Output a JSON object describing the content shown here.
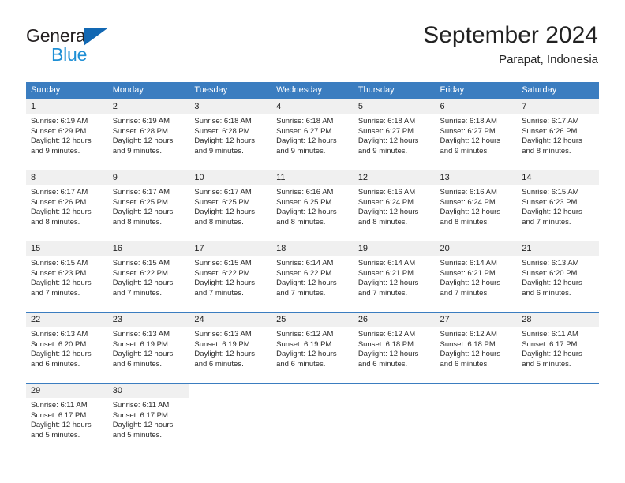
{
  "logo": {
    "word_top": "General",
    "word_bottom": "Blue",
    "triangle_color": "#1268b3",
    "blue_text_color": "#1e8fd5"
  },
  "header": {
    "title": "September 2024",
    "location": "Parapat, Indonesia"
  },
  "theme": {
    "header_blue": "#3b7dc0",
    "daynum_bg": "#f0f0f0",
    "text_color": "#2b2b2b"
  },
  "calendar": {
    "weekday_headers": [
      "Sunday",
      "Monday",
      "Tuesday",
      "Wednesday",
      "Thursday",
      "Friday",
      "Saturday"
    ],
    "weeks": [
      [
        {
          "day": "1",
          "sunrise": "Sunrise: 6:19 AM",
          "sunset": "Sunset: 6:29 PM",
          "daylight_1": "Daylight: 12 hours",
          "daylight_2": "and 9 minutes."
        },
        {
          "day": "2",
          "sunrise": "Sunrise: 6:19 AM",
          "sunset": "Sunset: 6:28 PM",
          "daylight_1": "Daylight: 12 hours",
          "daylight_2": "and 9 minutes."
        },
        {
          "day": "3",
          "sunrise": "Sunrise: 6:18 AM",
          "sunset": "Sunset: 6:28 PM",
          "daylight_1": "Daylight: 12 hours",
          "daylight_2": "and 9 minutes."
        },
        {
          "day": "4",
          "sunrise": "Sunrise: 6:18 AM",
          "sunset": "Sunset: 6:27 PM",
          "daylight_1": "Daylight: 12 hours",
          "daylight_2": "and 9 minutes."
        },
        {
          "day": "5",
          "sunrise": "Sunrise: 6:18 AM",
          "sunset": "Sunset: 6:27 PM",
          "daylight_1": "Daylight: 12 hours",
          "daylight_2": "and 9 minutes."
        },
        {
          "day": "6",
          "sunrise": "Sunrise: 6:18 AM",
          "sunset": "Sunset: 6:27 PM",
          "daylight_1": "Daylight: 12 hours",
          "daylight_2": "and 9 minutes."
        },
        {
          "day": "7",
          "sunrise": "Sunrise: 6:17 AM",
          "sunset": "Sunset: 6:26 PM",
          "daylight_1": "Daylight: 12 hours",
          "daylight_2": "and 8 minutes."
        }
      ],
      [
        {
          "day": "8",
          "sunrise": "Sunrise: 6:17 AM",
          "sunset": "Sunset: 6:26 PM",
          "daylight_1": "Daylight: 12 hours",
          "daylight_2": "and 8 minutes."
        },
        {
          "day": "9",
          "sunrise": "Sunrise: 6:17 AM",
          "sunset": "Sunset: 6:25 PM",
          "daylight_1": "Daylight: 12 hours",
          "daylight_2": "and 8 minutes."
        },
        {
          "day": "10",
          "sunrise": "Sunrise: 6:17 AM",
          "sunset": "Sunset: 6:25 PM",
          "daylight_1": "Daylight: 12 hours",
          "daylight_2": "and 8 minutes."
        },
        {
          "day": "11",
          "sunrise": "Sunrise: 6:16 AM",
          "sunset": "Sunset: 6:25 PM",
          "daylight_1": "Daylight: 12 hours",
          "daylight_2": "and 8 minutes."
        },
        {
          "day": "12",
          "sunrise": "Sunrise: 6:16 AM",
          "sunset": "Sunset: 6:24 PM",
          "daylight_1": "Daylight: 12 hours",
          "daylight_2": "and 8 minutes."
        },
        {
          "day": "13",
          "sunrise": "Sunrise: 6:16 AM",
          "sunset": "Sunset: 6:24 PM",
          "daylight_1": "Daylight: 12 hours",
          "daylight_2": "and 8 minutes."
        },
        {
          "day": "14",
          "sunrise": "Sunrise: 6:15 AM",
          "sunset": "Sunset: 6:23 PM",
          "daylight_1": "Daylight: 12 hours",
          "daylight_2": "and 7 minutes."
        }
      ],
      [
        {
          "day": "15",
          "sunrise": "Sunrise: 6:15 AM",
          "sunset": "Sunset: 6:23 PM",
          "daylight_1": "Daylight: 12 hours",
          "daylight_2": "and 7 minutes."
        },
        {
          "day": "16",
          "sunrise": "Sunrise: 6:15 AM",
          "sunset": "Sunset: 6:22 PM",
          "daylight_1": "Daylight: 12 hours",
          "daylight_2": "and 7 minutes."
        },
        {
          "day": "17",
          "sunrise": "Sunrise: 6:15 AM",
          "sunset": "Sunset: 6:22 PM",
          "daylight_1": "Daylight: 12 hours",
          "daylight_2": "and 7 minutes."
        },
        {
          "day": "18",
          "sunrise": "Sunrise: 6:14 AM",
          "sunset": "Sunset: 6:22 PM",
          "daylight_1": "Daylight: 12 hours",
          "daylight_2": "and 7 minutes."
        },
        {
          "day": "19",
          "sunrise": "Sunrise: 6:14 AM",
          "sunset": "Sunset: 6:21 PM",
          "daylight_1": "Daylight: 12 hours",
          "daylight_2": "and 7 minutes."
        },
        {
          "day": "20",
          "sunrise": "Sunrise: 6:14 AM",
          "sunset": "Sunset: 6:21 PM",
          "daylight_1": "Daylight: 12 hours",
          "daylight_2": "and 7 minutes."
        },
        {
          "day": "21",
          "sunrise": "Sunrise: 6:13 AM",
          "sunset": "Sunset: 6:20 PM",
          "daylight_1": "Daylight: 12 hours",
          "daylight_2": "and 6 minutes."
        }
      ],
      [
        {
          "day": "22",
          "sunrise": "Sunrise: 6:13 AM",
          "sunset": "Sunset: 6:20 PM",
          "daylight_1": "Daylight: 12 hours",
          "daylight_2": "and 6 minutes."
        },
        {
          "day": "23",
          "sunrise": "Sunrise: 6:13 AM",
          "sunset": "Sunset: 6:19 PM",
          "daylight_1": "Daylight: 12 hours",
          "daylight_2": "and 6 minutes."
        },
        {
          "day": "24",
          "sunrise": "Sunrise: 6:13 AM",
          "sunset": "Sunset: 6:19 PM",
          "daylight_1": "Daylight: 12 hours",
          "daylight_2": "and 6 minutes."
        },
        {
          "day": "25",
          "sunrise": "Sunrise: 6:12 AM",
          "sunset": "Sunset: 6:19 PM",
          "daylight_1": "Daylight: 12 hours",
          "daylight_2": "and 6 minutes."
        },
        {
          "day": "26",
          "sunrise": "Sunrise: 6:12 AM",
          "sunset": "Sunset: 6:18 PM",
          "daylight_1": "Daylight: 12 hours",
          "daylight_2": "and 6 minutes."
        },
        {
          "day": "27",
          "sunrise": "Sunrise: 6:12 AM",
          "sunset": "Sunset: 6:18 PM",
          "daylight_1": "Daylight: 12 hours",
          "daylight_2": "and 6 minutes."
        },
        {
          "day": "28",
          "sunrise": "Sunrise: 6:11 AM",
          "sunset": "Sunset: 6:17 PM",
          "daylight_1": "Daylight: 12 hours",
          "daylight_2": "and 5 minutes."
        }
      ],
      [
        {
          "day": "29",
          "sunrise": "Sunrise: 6:11 AM",
          "sunset": "Sunset: 6:17 PM",
          "daylight_1": "Daylight: 12 hours",
          "daylight_2": "and 5 minutes."
        },
        {
          "day": "30",
          "sunrise": "Sunrise: 6:11 AM",
          "sunset": "Sunset: 6:17 PM",
          "daylight_1": "Daylight: 12 hours",
          "daylight_2": "and 5 minutes."
        },
        {
          "day": "",
          "sunrise": "",
          "sunset": "",
          "daylight_1": "",
          "daylight_2": ""
        },
        {
          "day": "",
          "sunrise": "",
          "sunset": "",
          "daylight_1": "",
          "daylight_2": ""
        },
        {
          "day": "",
          "sunrise": "",
          "sunset": "",
          "daylight_1": "",
          "daylight_2": ""
        },
        {
          "day": "",
          "sunrise": "",
          "sunset": "",
          "daylight_1": "",
          "daylight_2": ""
        },
        {
          "day": "",
          "sunrise": "",
          "sunset": "",
          "daylight_1": "",
          "daylight_2": ""
        }
      ]
    ]
  }
}
